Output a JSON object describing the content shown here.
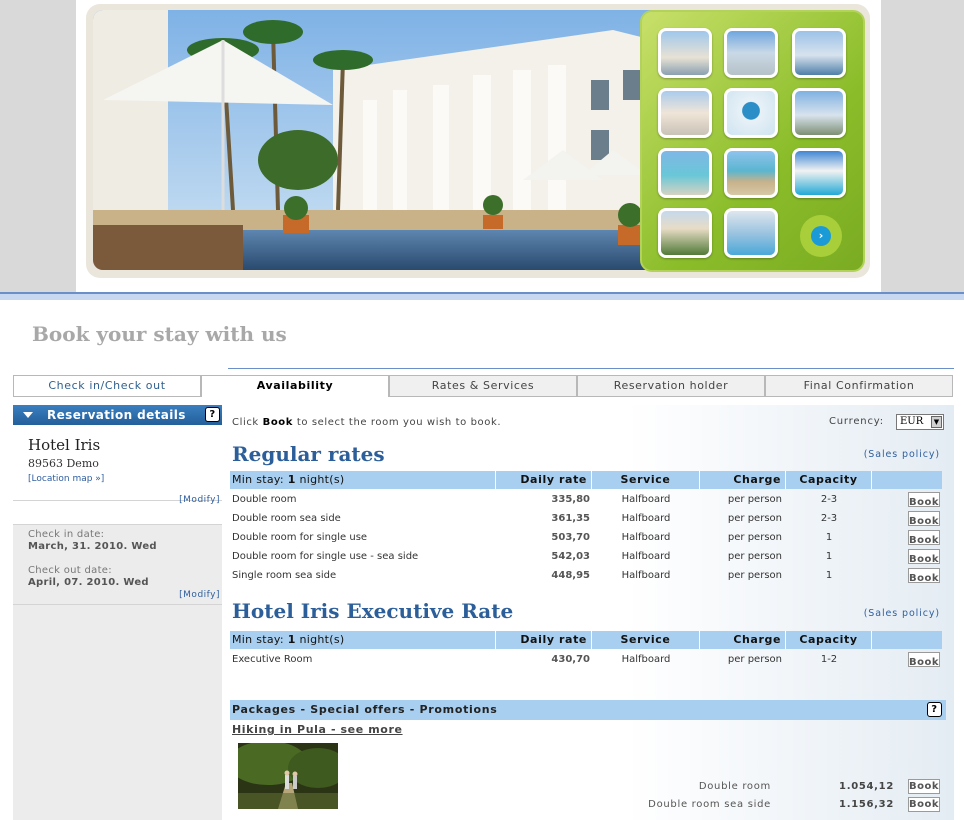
{
  "page_title": "Book your stay with us",
  "tabs": [
    "Check in/Check out",
    "Availability",
    "Rates & Services",
    "Reservation holder",
    "Final Confirmation"
  ],
  "sidebar": {
    "header": "Reservation details",
    "hotel_name": "Hotel Iris",
    "hotel_address": "89563 Demo",
    "location_link": "[Location map »]",
    "modify": "[Modify]",
    "checkin_label": "Check in date:",
    "checkin_value": "March, 31. 2010. Wed",
    "checkout_label": "Check out date:",
    "checkout_value": "April, 07. 2010. Wed"
  },
  "main": {
    "intro_pre": "Click",
    "intro_bold": "Book",
    "intro_post": "to select the room you wish to book.",
    "currency_label": "Currency:",
    "currency_value": "EUR",
    "sales_policy": "(Sales policy)",
    "book_label": "Book",
    "headers": {
      "min_stay_pre": "Min stay:",
      "min_stay_num": "1",
      "min_stay_post": "night(s)",
      "daily_rate": "Daily rate",
      "service": "Service",
      "charge": "Charge",
      "capacity": "Capacity"
    },
    "regular": {
      "title": "Regular rates",
      "rows": [
        {
          "room": "Double room",
          "rate": "335,80",
          "service": "Halfboard",
          "charge": "per person",
          "capacity": "2-3"
        },
        {
          "room": "Double room sea side",
          "rate": "361,35",
          "service": "Halfboard",
          "charge": "per person",
          "capacity": "2-3"
        },
        {
          "room": "Double room for single use",
          "rate": "503,70",
          "service": "Halfboard",
          "charge": "per person",
          "capacity": "1"
        },
        {
          "room": "Double room for single use - sea side",
          "rate": "542,03",
          "service": "Halfboard",
          "charge": "per person",
          "capacity": "1"
        },
        {
          "room": "Single room sea side",
          "rate": "448,95",
          "service": "Halfboard",
          "charge": "per person",
          "capacity": "1"
        }
      ]
    },
    "executive": {
      "title": "Hotel Iris Executive Rate",
      "rows": [
        {
          "room": "Executive Room",
          "rate": "430,70",
          "service": "Halfboard",
          "charge": "per person",
          "capacity": "1-2"
        }
      ]
    },
    "packages": {
      "header": "Packages - Special offers - Promotions",
      "link": "Hiking in Pula - see more",
      "rows": [
        {
          "room": "Double room",
          "price": "1.054,12"
        },
        {
          "room": "Double room sea side",
          "price": "1.156,32"
        }
      ]
    }
  },
  "colors": {
    "accent_blue": "#2c5f99",
    "header_blue": "#a9cff0",
    "sidebar_head": "#2f6fae",
    "gallery_green": "#8bbd2a"
  }
}
